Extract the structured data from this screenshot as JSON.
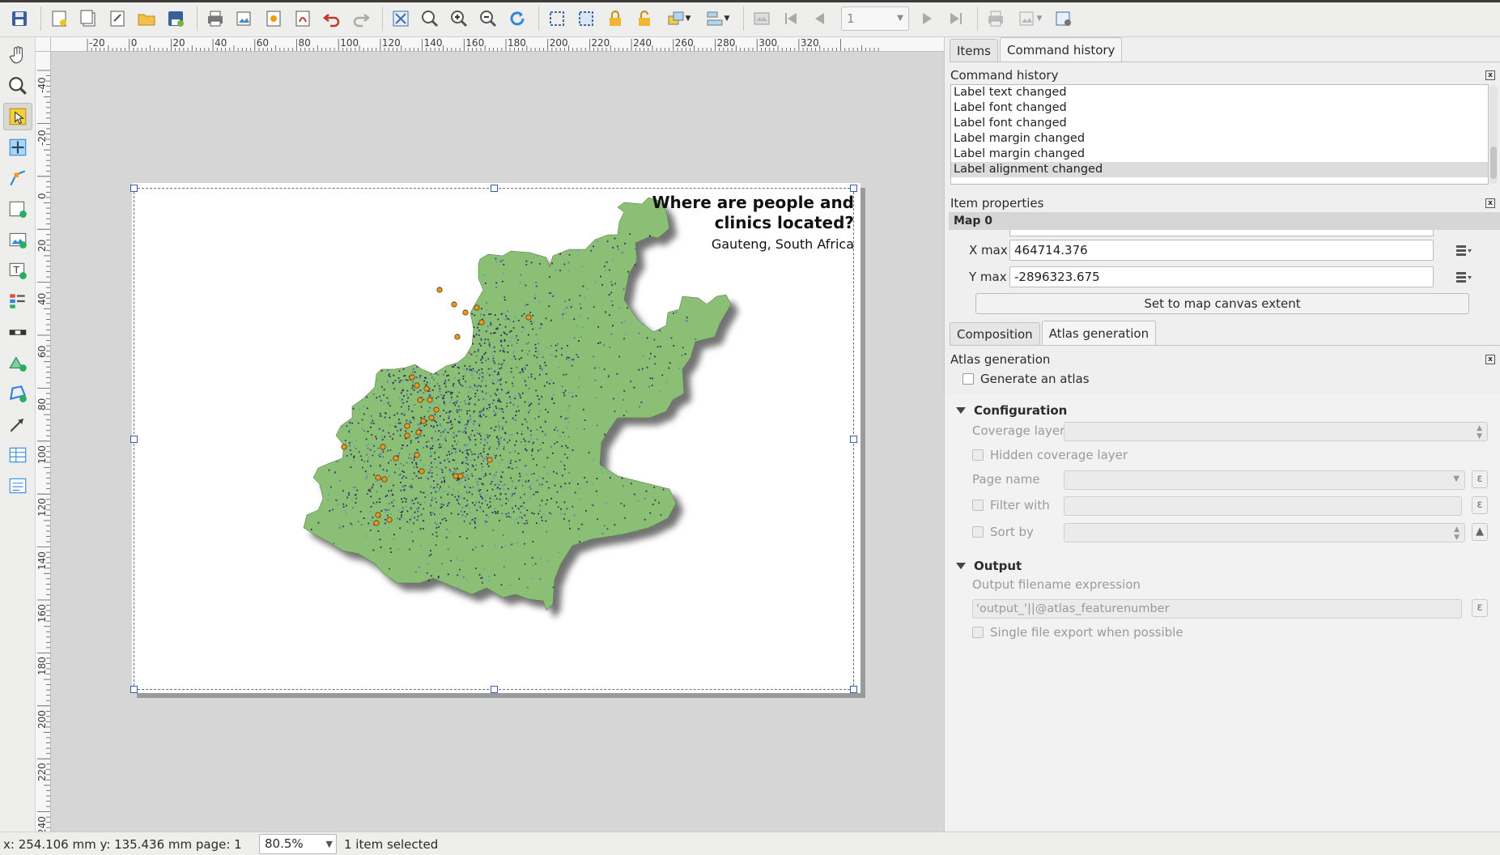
{
  "toolbar": {
    "page_number": "1",
    "icons": [
      "save-icon",
      "new-composer-icon",
      "duplicate-composer-icon",
      "composer-manager-icon",
      "open-template-icon",
      "save-template-icon",
      "print-icon",
      "export-image-icon",
      "export-svg-icon",
      "export-pdf-icon",
      "undo-icon",
      "redo-icon",
      "zoom-full-icon",
      "zoom-100-icon",
      "zoom-in-icon",
      "zoom-out-icon",
      "refresh-icon",
      "lock-icon",
      "unlock-icon",
      "group-icon",
      "ungroup-icon",
      "raise-icon",
      "align-icon",
      "atlas-preview-icon",
      "first-feature-icon",
      "prev-feature-icon",
      "next-feature-icon",
      "last-feature-icon",
      "atlas-print-icon",
      "atlas-export-icon",
      "atlas-settings-icon"
    ]
  },
  "ruler": {
    "h_labels": [
      "-20",
      "0",
      "20",
      "40",
      "60",
      "80",
      "100",
      "120",
      "140",
      "160",
      "180",
      "200",
      "220",
      "240",
      "260",
      "280",
      "300",
      "320"
    ],
    "v_labels": [
      "-40",
      "-20",
      "0",
      "20",
      "40",
      "60",
      "80",
      "100",
      "120",
      "140",
      "160",
      "180",
      "200",
      "220",
      "240"
    ]
  },
  "map": {
    "title": "Where are people and clinics located?",
    "subtitle": "Gauteng, South Africa",
    "region_color": "#8bbf74",
    "clinic_color": "#e39a26"
  },
  "right_panel": {
    "top_tabs": [
      "Items",
      "Command history"
    ],
    "command_history": {
      "title": "Command history",
      "items": [
        "Label text changed",
        "Label font changed",
        "Label font changed",
        "Label margin changed",
        "Label margin changed",
        "Label alignment changed"
      ],
      "selected_index": 5
    },
    "item_properties": {
      "title": "Item properties",
      "item_name": "Map 0",
      "x_max_label": "X max",
      "x_max_value": "464714.376",
      "y_max_label": "Y max",
      "y_max_value": "-2896323.675",
      "set_extent_label": "Set to map canvas extent"
    },
    "bottom_tabs": [
      "Composition",
      "Atlas generation"
    ],
    "atlas": {
      "title": "Atlas generation",
      "generate_label": "Generate an atlas",
      "configuration": "Configuration",
      "coverage_layer": "Coverage layer",
      "hidden_coverage": "Hidden coverage layer",
      "page_name": "Page name",
      "filter_with": "Filter with",
      "sort_by": "Sort by",
      "output": "Output",
      "output_expr_label": "Output filename expression",
      "output_expr_value": "'output_'||@atlas_featurenumber",
      "single_file": "Single file export when possible"
    }
  },
  "status": {
    "coords": "x: 254.106 mm  y: 135.436 mm  page: 1",
    "zoom": "80.5%",
    "selection": "1 item selected"
  },
  "colors": {
    "ui_background": "#efefef",
    "canvas_background": "#d6d6d6",
    "selection_handle": "#3a5fa8"
  }
}
